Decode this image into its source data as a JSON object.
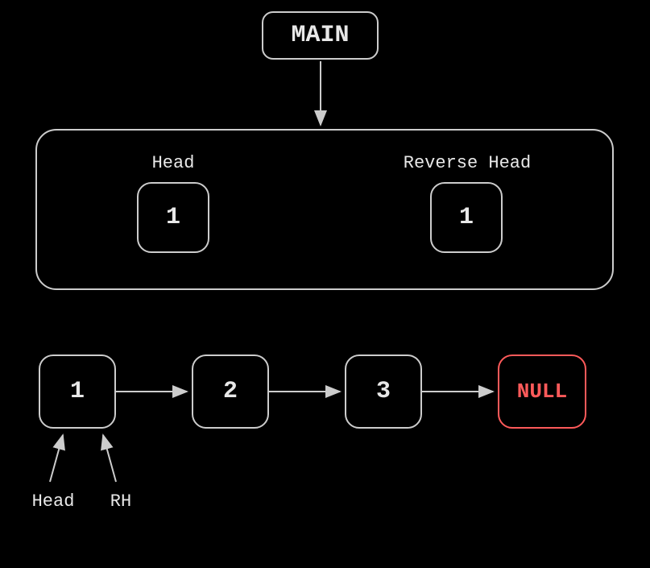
{
  "main": {
    "label": "MAIN"
  },
  "frame": {
    "head": {
      "label": "Head",
      "value": "1"
    },
    "reverseHead": {
      "label": "Reverse Head",
      "value": "1"
    }
  },
  "list": {
    "nodes": [
      "1",
      "2",
      "3"
    ],
    "terminator": "NULL"
  },
  "pointers": {
    "head": "Head",
    "rh": "RH"
  }
}
